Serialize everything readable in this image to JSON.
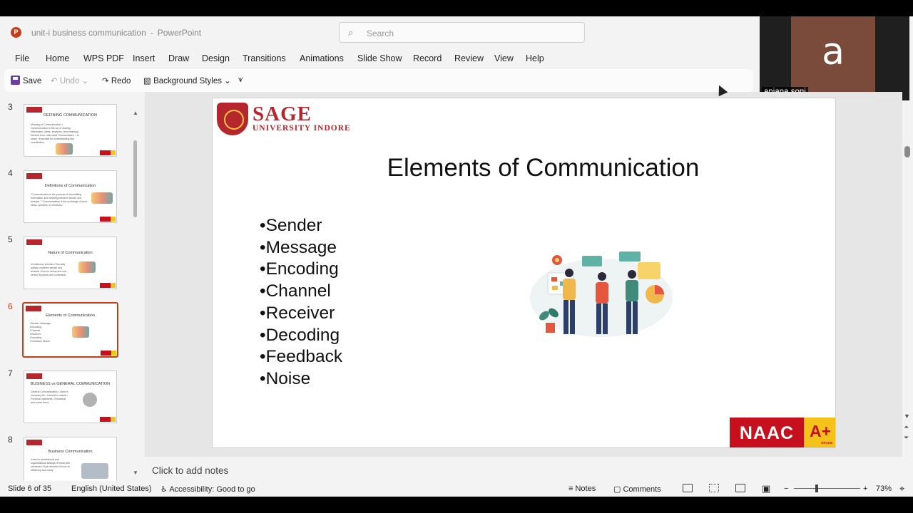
{
  "app": {
    "document_name": "unit-i business communication",
    "app_name": "PowerPoint",
    "separator": "-",
    "logo_letter": "P"
  },
  "search": {
    "placeholder": "Search"
  },
  "menu": [
    "File",
    "Home",
    "WPS PDF",
    "Insert",
    "Draw",
    "Design",
    "Transitions",
    "Animations",
    "Slide Show",
    "Record",
    "Review",
    "View",
    "Help"
  ],
  "toolbar": {
    "save": "Save",
    "undo": "Undo",
    "redo": "Redo",
    "background_styles": "Background Styles"
  },
  "webcam": {
    "initial": "a",
    "name": "anjana soni"
  },
  "thumbnails": [
    {
      "number": "3",
      "title": "DEFINING COMMUNICATION",
      "body": "Meaning of Communication • Communication is the act of sharing information, ideas, emotions, and meaning • Derived from Latin word 'Communicare' – to share • Essential for understanding and coordination",
      "selected": false
    },
    {
      "number": "4",
      "title": "Definitions of Communication",
      "body": "\"Communication is the process of transmitting information and meaning between sender and receiver.\" \"Communication is the exchange of facts, ideas, opinions, or emotions.\"",
      "selected": false
    },
    {
      "number": "5",
      "title": "Nature of Communication",
      "body": "•Continuous process •Two-way activity •Involves sender and receiver •Can be verbal and non-verbal •Dynamic and contextual",
      "selected": false
    },
    {
      "number": "6",
      "title": "Elements of Communication",
      "body": "•Sender •Message •Encoding •Channel •Receiver •Decoding •Feedback •Noise",
      "selected": true
    },
    {
      "number": "7",
      "title": "BUSINESS vs GENERAL COMMUNICATION",
      "body": "General Communication • Used in everyday life • Informal in nature • Personal objectives • Emotional and social focus",
      "selected": false
    },
    {
      "number": "8",
      "title": "Business Communication",
      "body": "•Used in professional and organizational settings •Formal and structured •Goal oriented •Focus on efficiency and clarity",
      "selected": false
    }
  ],
  "slide": {
    "logo_name": "SAGE",
    "logo_sub": "UNIVERSITY INDORE",
    "title": "Elements of Communication",
    "bullets": [
      "Sender",
      "Message",
      "Encoding",
      "Channel",
      "Receiver",
      "Decoding",
      "Feedback",
      "Noise"
    ],
    "naac_text": "NAAC",
    "naac_grade": "A+",
    "naac_grade_label": "GRADE"
  },
  "notes_placeholder": "Click to add notes",
  "status": {
    "slide_info": "Slide 6 of 35",
    "language": "English (United States)",
    "accessibility": "Accessibility: Good to go",
    "notes": "Notes",
    "comments": "Comments",
    "zoom": "73%"
  },
  "colors": {
    "accent_ppt": "#c43e1c",
    "sage_red": "#b5272d",
    "naac_red": "#c7101d",
    "naac_yellow": "#f4c21a"
  }
}
